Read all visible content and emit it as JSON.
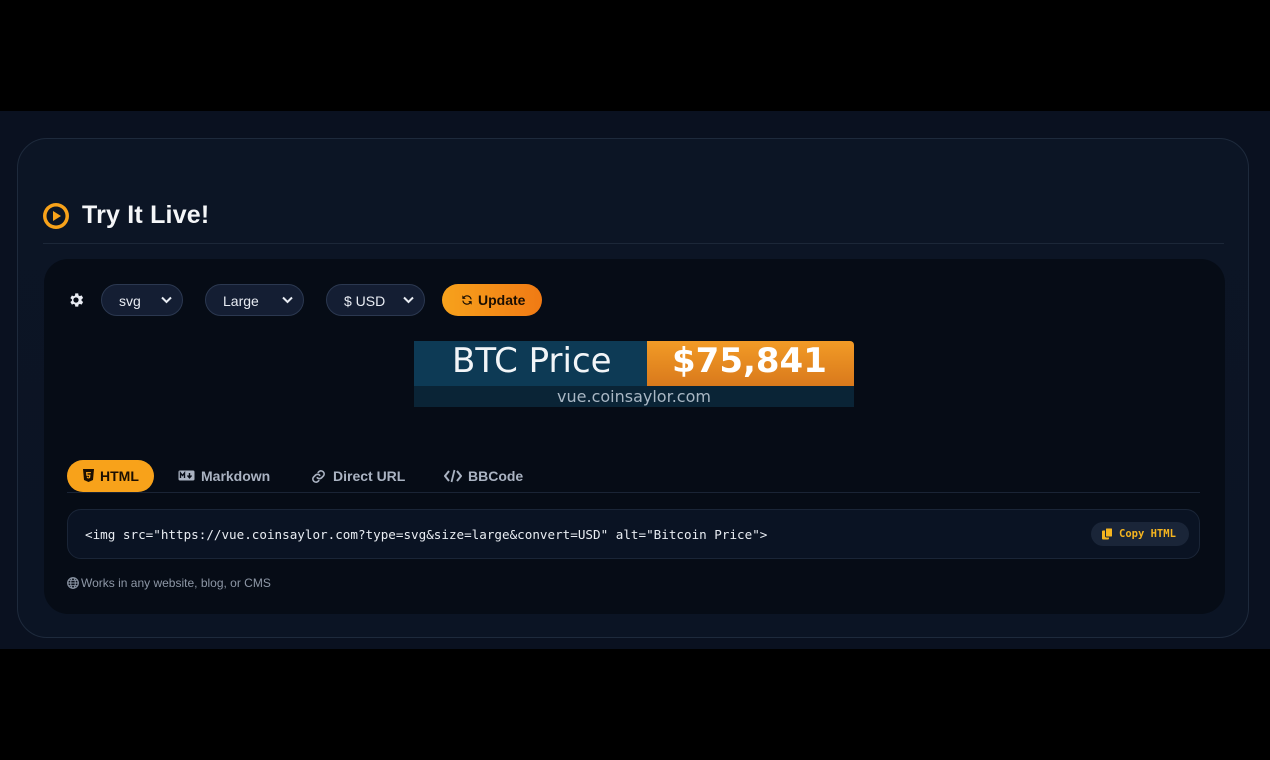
{
  "section": {
    "title": "Try It Live!"
  },
  "controls": {
    "format_select": "svg",
    "size_select": "Large",
    "currency_select": "$ USD",
    "update_label": "Update"
  },
  "badge": {
    "label": "BTC Price",
    "price": "$75,841",
    "site": "vue.coinsaylor.com"
  },
  "tabs": [
    {
      "label": "HTML",
      "icon": "html5-icon",
      "active": true
    },
    {
      "label": "Markdown",
      "icon": "markdown-icon",
      "active": false
    },
    {
      "label": "Direct URL",
      "icon": "link-icon",
      "active": false
    },
    {
      "label": "BBCode",
      "icon": "code-icon",
      "active": false
    }
  ],
  "snippet": {
    "code": "<img src=\"https://vue.coinsaylor.com?type=svg&size=large&convert=USD\" alt=\"Bitcoin Price\">",
    "copy_label": "Copy HTML"
  },
  "note": "Works in any website, blog, or CMS",
  "colors": {
    "accent": "#f8a21a",
    "background": "#0a1120",
    "panel": "#060c16"
  }
}
